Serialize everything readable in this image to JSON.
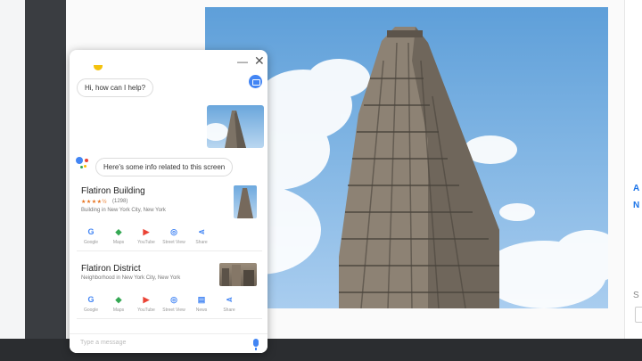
{
  "assistant": {
    "greeting": "Hi, how can I help?",
    "info_message": "Here's some info related to this screen",
    "input_placeholder": "Type a message",
    "cards": [
      {
        "title": "Flatiron Building",
        "stars": "★★★★½",
        "rating_count": "(1298)",
        "subtitle": "Building in New York City, New York",
        "actions": [
          {
            "label": "Google",
            "icon": "google-icon"
          },
          {
            "label": "Maps",
            "icon": "maps-icon"
          },
          {
            "label": "YouTube",
            "icon": "youtube-icon"
          },
          {
            "label": "Street View",
            "icon": "street-view-icon"
          },
          {
            "label": "Share",
            "icon": "share-icon"
          }
        ]
      },
      {
        "title": "Flatiron District",
        "subtitle": "Neighborhood in New York City, New York",
        "actions": [
          {
            "label": "Google",
            "icon": "google-icon"
          },
          {
            "label": "Maps",
            "icon": "maps-icon"
          },
          {
            "label": "YouTube",
            "icon": "youtube-icon"
          },
          {
            "label": "Street View",
            "icon": "street-view-icon"
          },
          {
            "label": "News",
            "icon": "news-icon"
          },
          {
            "label": "Share",
            "icon": "share-icon"
          }
        ]
      }
    ]
  },
  "side": {
    "link_a": "A",
    "link_n": "N",
    "label_s": "S"
  },
  "colors": {
    "accent": "#4285f4",
    "taskbar": "#2b2d30",
    "sky": "#7fb4e3"
  }
}
